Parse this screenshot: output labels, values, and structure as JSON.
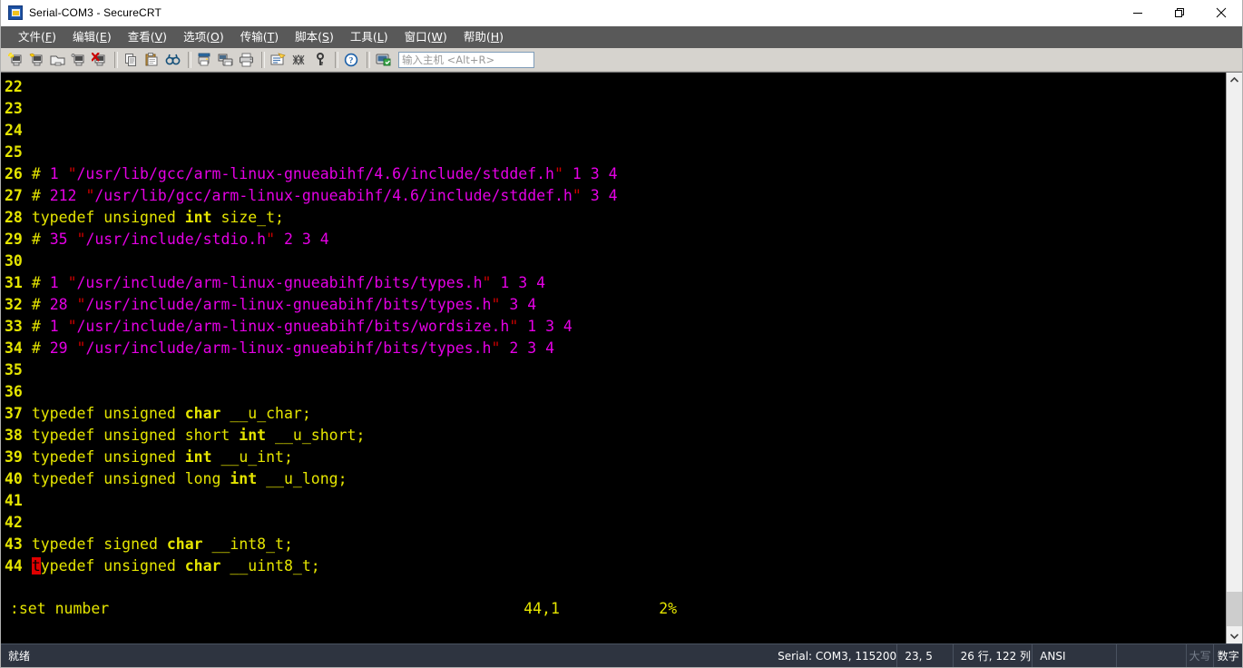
{
  "window": {
    "title": "Serial-COM3 - SecureCRT",
    "icon": "securecrt-app-icon",
    "controls": {
      "minimize": "minimize-icon",
      "restore": "restore-icon",
      "close": "close-icon"
    }
  },
  "menu": {
    "items": [
      {
        "name": "文件",
        "key": "F"
      },
      {
        "name": "编辑",
        "key": "E"
      },
      {
        "name": "查看",
        "key": "V"
      },
      {
        "name": "选项",
        "key": "O"
      },
      {
        "name": "传输",
        "key": "T"
      },
      {
        "name": "脚本",
        "key": "S"
      },
      {
        "name": "工具",
        "key": "L"
      },
      {
        "name": "窗口",
        "key": "W"
      },
      {
        "name": "帮助",
        "key": "H"
      }
    ]
  },
  "toolbar": {
    "host_input_placeholder": "输入主机 <Alt+R>",
    "host_input_value": "",
    "icons": [
      "new-session-icon",
      "connect-icon",
      "quick-connect-icon",
      "connect-sftp-icon",
      "disconnect-icon",
      "copy-icon",
      "paste-icon",
      "find-icon",
      "print-screen-icon",
      "log-session-icon",
      "print-icon",
      "session-options-icon",
      "global-options-icon",
      "key-icon",
      "help-icon",
      "screen-capture-icon"
    ]
  },
  "terminal": {
    "lines": [
      {
        "num": "22",
        "tokens": []
      },
      {
        "num": "23",
        "tokens": []
      },
      {
        "num": "24",
        "tokens": []
      },
      {
        "num": "25",
        "tokens": []
      },
      {
        "num": "26",
        "tokens": [
          {
            "t": "hash",
            "v": "# "
          },
          {
            "t": "pp",
            "v": "1 "
          },
          {
            "t": "quote",
            "v": "\""
          },
          {
            "t": "pp",
            "v": "/usr/lib/gcc/arm-linux-gnueabihf/4.6/include/stddef.h"
          },
          {
            "t": "quote",
            "v": "\""
          },
          {
            "t": "pp",
            "v": " 1 3 4"
          }
        ]
      },
      {
        "num": "27",
        "tokens": [
          {
            "t": "hash",
            "v": "# "
          },
          {
            "t": "pp",
            "v": "212 "
          },
          {
            "t": "quote",
            "v": "\""
          },
          {
            "t": "pp",
            "v": "/usr/lib/gcc/arm-linux-gnueabihf/4.6/include/stddef.h"
          },
          {
            "t": "quote",
            "v": "\""
          },
          {
            "t": "pp",
            "v": " 3 4"
          }
        ]
      },
      {
        "num": "28",
        "tokens": [
          {
            "t": "plain",
            "v": "typedef unsigned "
          },
          {
            "t": "kw",
            "v": "int"
          },
          {
            "t": "plain",
            "v": " size_t;"
          }
        ]
      },
      {
        "num": "29",
        "tokens": [
          {
            "t": "hash",
            "v": "# "
          },
          {
            "t": "pp",
            "v": "35 "
          },
          {
            "t": "quote",
            "v": "\""
          },
          {
            "t": "pp",
            "v": "/usr/include/stdio.h"
          },
          {
            "t": "quote",
            "v": "\""
          },
          {
            "t": "pp",
            "v": " 2 3 4"
          }
        ]
      },
      {
        "num": "30",
        "tokens": []
      },
      {
        "num": "31",
        "tokens": [
          {
            "t": "hash",
            "v": "# "
          },
          {
            "t": "pp",
            "v": "1 "
          },
          {
            "t": "quote",
            "v": "\""
          },
          {
            "t": "pp",
            "v": "/usr/include/arm-linux-gnueabihf/bits/types.h"
          },
          {
            "t": "quote",
            "v": "\""
          },
          {
            "t": "pp",
            "v": " 1 3 4"
          }
        ]
      },
      {
        "num": "32",
        "tokens": [
          {
            "t": "hash",
            "v": "# "
          },
          {
            "t": "pp",
            "v": "28 "
          },
          {
            "t": "quote",
            "v": "\""
          },
          {
            "t": "pp",
            "v": "/usr/include/arm-linux-gnueabihf/bits/types.h"
          },
          {
            "t": "quote",
            "v": "\""
          },
          {
            "t": "pp",
            "v": " 3 4"
          }
        ]
      },
      {
        "num": "33",
        "tokens": [
          {
            "t": "hash",
            "v": "# "
          },
          {
            "t": "pp",
            "v": "1 "
          },
          {
            "t": "quote",
            "v": "\""
          },
          {
            "t": "pp",
            "v": "/usr/include/arm-linux-gnueabihf/bits/wordsize.h"
          },
          {
            "t": "quote",
            "v": "\""
          },
          {
            "t": "pp",
            "v": " 1 3 4"
          }
        ]
      },
      {
        "num": "34",
        "tokens": [
          {
            "t": "hash",
            "v": "# "
          },
          {
            "t": "pp",
            "v": "29 "
          },
          {
            "t": "quote",
            "v": "\""
          },
          {
            "t": "pp",
            "v": "/usr/include/arm-linux-gnueabihf/bits/types.h"
          },
          {
            "t": "quote",
            "v": "\""
          },
          {
            "t": "pp",
            "v": " 2 3 4"
          }
        ]
      },
      {
        "num": "35",
        "tokens": []
      },
      {
        "num": "36",
        "tokens": []
      },
      {
        "num": "37",
        "tokens": [
          {
            "t": "plain",
            "v": "typedef unsigned "
          },
          {
            "t": "kw",
            "v": "char"
          },
          {
            "t": "plain",
            "v": " __u_char;"
          }
        ]
      },
      {
        "num": "38",
        "tokens": [
          {
            "t": "plain",
            "v": "typedef unsigned short "
          },
          {
            "t": "kw",
            "v": "int"
          },
          {
            "t": "plain",
            "v": " __u_short;"
          }
        ]
      },
      {
        "num": "39",
        "tokens": [
          {
            "t": "plain",
            "v": "typedef unsigned "
          },
          {
            "t": "kw",
            "v": "int"
          },
          {
            "t": "plain",
            "v": " __u_int;"
          }
        ]
      },
      {
        "num": "40",
        "tokens": [
          {
            "t": "plain",
            "v": "typedef unsigned long "
          },
          {
            "t": "kw",
            "v": "int"
          },
          {
            "t": "plain",
            "v": " __u_long;"
          }
        ]
      },
      {
        "num": "41",
        "tokens": []
      },
      {
        "num": "42",
        "tokens": []
      },
      {
        "num": "43",
        "tokens": [
          {
            "t": "plain",
            "v": "typedef signed "
          },
          {
            "t": "kw",
            "v": "char"
          },
          {
            "t": "plain",
            "v": " __int8_t;"
          }
        ]
      },
      {
        "num": "44",
        "tokens": [
          {
            "t": "cursor",
            "v": "t"
          },
          {
            "t": "plain",
            "v": "ypedef unsigned "
          },
          {
            "t": "kw",
            "v": "char"
          },
          {
            "t": "plain",
            "v": " __uint8_t;"
          }
        ]
      }
    ],
    "command_line": ":set number",
    "ruler_position": "44,1",
    "ruler_percent": "2%",
    "colors": {
      "background": "#000000",
      "line_number": "#e5e500",
      "keyword": "#e5e500",
      "preprocessor": "#e500e5",
      "string_quote": "#cc0000",
      "cursor": "#e00000"
    }
  },
  "scrollbar": {
    "up_arrow": "chevron-up-icon",
    "down_arrow": "chevron-down-icon"
  },
  "statusbar": {
    "ready": "就绪",
    "serial": "Serial: COM3, 115200",
    "position": "23,    5",
    "dimensions": "26 行, 122 列",
    "encoding": "ANSI",
    "blank": "",
    "caps": "大写",
    "num": "数字"
  }
}
